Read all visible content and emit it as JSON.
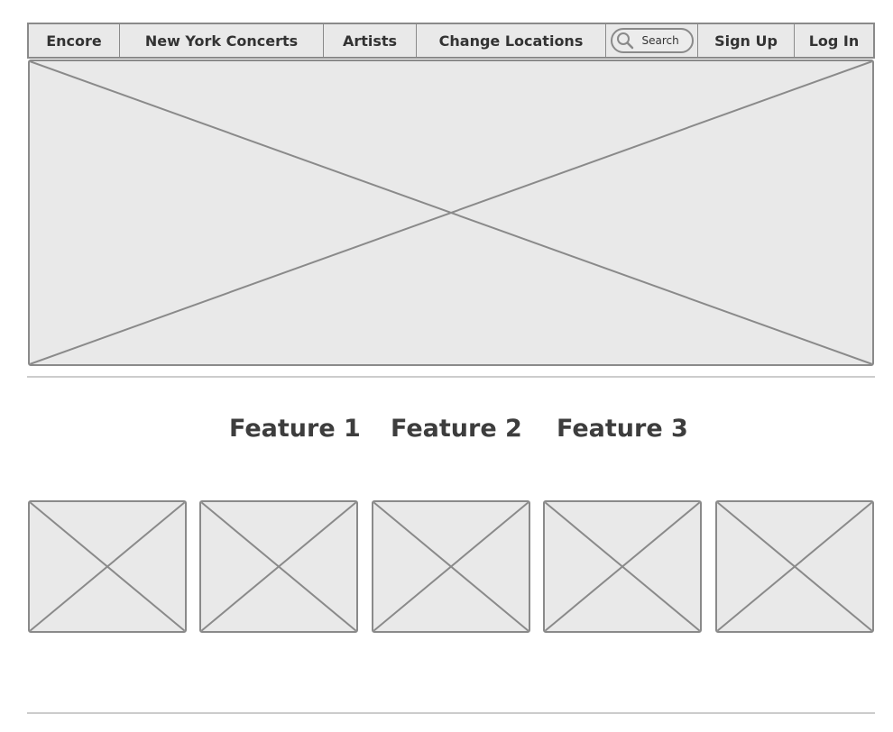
{
  "nav": {
    "brand": "Encore",
    "city_concerts": "New York Concerts",
    "artists": "Artists",
    "change_locations": "Change Locations",
    "search_placeholder": "Search",
    "sign_up": "Sign Up",
    "log_in": "Log In"
  },
  "features": {
    "items": [
      {
        "label": "Feature 1"
      },
      {
        "label": "Feature 2"
      },
      {
        "label": "Feature 3"
      }
    ]
  },
  "colors": {
    "placeholder_fill": "#e9e9e9",
    "placeholder_stroke": "#8a8a8a",
    "divider": "#cccccc",
    "text": "#333333"
  },
  "icons": {
    "search": "search-icon"
  }
}
